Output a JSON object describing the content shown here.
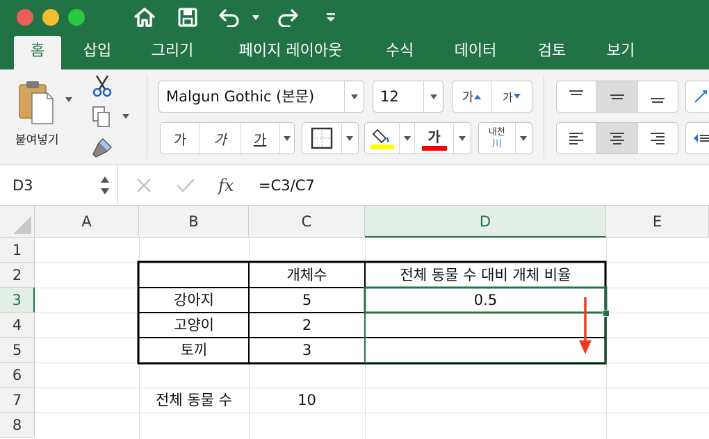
{
  "titlebar": {
    "quick_access": [
      "home-icon",
      "save-icon",
      "undo-icon",
      "redo-icon",
      "customize-icon"
    ]
  },
  "tabs": [
    {
      "label": "홈",
      "active": true
    },
    {
      "label": "삽입"
    },
    {
      "label": "그리기"
    },
    {
      "label": "페이지 레이아웃"
    },
    {
      "label": "수식"
    },
    {
      "label": "데이터"
    },
    {
      "label": "검토"
    },
    {
      "label": "보기"
    }
  ],
  "ribbon": {
    "paste_label": "붙여넣기",
    "font_name": "Malgun Gothic (본문)",
    "font_size": "12",
    "grow_font": "가",
    "shrink_font": "가",
    "bold": "가",
    "italic": "가",
    "underline": "가",
    "font_color_glyph": "가",
    "phonetic_top": "내천",
    "phonetic_bottom": "川",
    "fill_color": "#ffff00",
    "font_color": "#ff0000"
  },
  "formula_bar": {
    "name_box": "D3",
    "fx": "fx",
    "formula": "=C3/C7"
  },
  "sheet": {
    "columns": [
      "A",
      "B",
      "C",
      "D",
      "E"
    ],
    "rows": [
      "1",
      "2",
      "3",
      "4",
      "5",
      "6",
      "7",
      "8"
    ],
    "selected_cell": "D3",
    "cells": {
      "C2": "개체수",
      "D2": "전체 동물 수 대비 개체 비율",
      "B3": "강아지",
      "C3": "5",
      "D3": "0.5",
      "B4": "고양이",
      "C4": "2",
      "B5": "토끼",
      "C5": "3",
      "B7": "전체 동물 수",
      "C7": "10"
    },
    "annotation_arrow_color": "#ee3a1f",
    "accent_color": "#217346"
  }
}
